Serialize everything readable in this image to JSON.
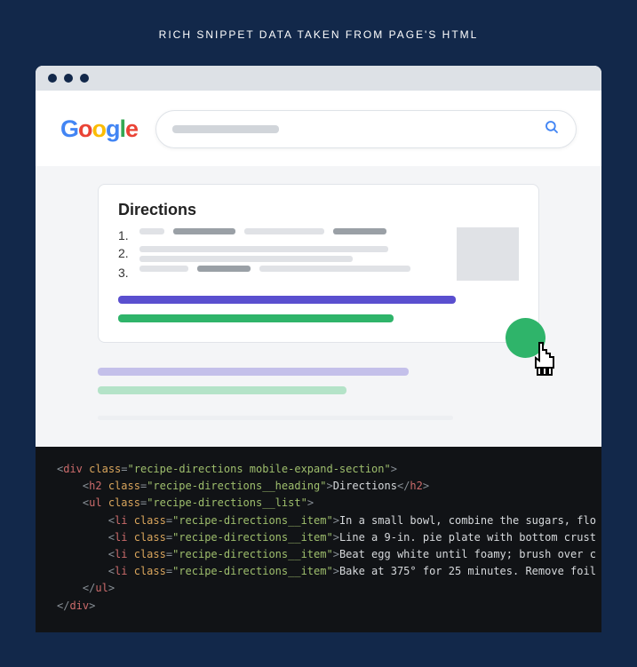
{
  "heading": "RICH SNIPPET DATA TAKEN FROM PAGE'S HTML",
  "logo": {
    "letters": "Google"
  },
  "search": {
    "placeholder": ""
  },
  "snippet": {
    "title": "Directions",
    "items": [
      "1.",
      "2.",
      "3."
    ]
  },
  "code": {
    "lines": [
      {
        "indent": 0,
        "open": "div",
        "attrs": [
          [
            "class",
            "recipe-directions mobile-expand-section"
          ]
        ]
      },
      {
        "indent": 1,
        "open": "h2",
        "attrs": [
          [
            "class",
            "recipe-directions__heading"
          ]
        ],
        "text": "Directions",
        "close": "h2"
      },
      {
        "indent": 1,
        "open": "ul",
        "attrs": [
          [
            "class",
            "recipe-directions__list"
          ]
        ]
      },
      {
        "indent": 2,
        "open": "li",
        "attrs": [
          [
            "class",
            "recipe-directions__item"
          ]
        ],
        "text": "In a small bowl, combine the sugars, flo",
        "clip": true
      },
      {
        "indent": 2,
        "open": "li",
        "attrs": [
          [
            "class",
            "recipe-directions__item"
          ]
        ],
        "text": "Line a 9-in. pie plate with bottom crust",
        "clip": true
      },
      {
        "indent": 2,
        "open": "li",
        "attrs": [
          [
            "class",
            "recipe-directions__item"
          ]
        ],
        "text": "Beat egg white until foamy; brush over c",
        "clip": true
      },
      {
        "indent": 2,
        "open": "li",
        "attrs": [
          [
            "class",
            "recipe-directions__item"
          ]
        ],
        "text": "Bake at 375° for 25 minutes. Remove foil",
        "clip": true
      },
      {
        "indent": 1,
        "closeonly": "ul"
      },
      {
        "indent": 0,
        "closeonly": "div"
      }
    ]
  }
}
